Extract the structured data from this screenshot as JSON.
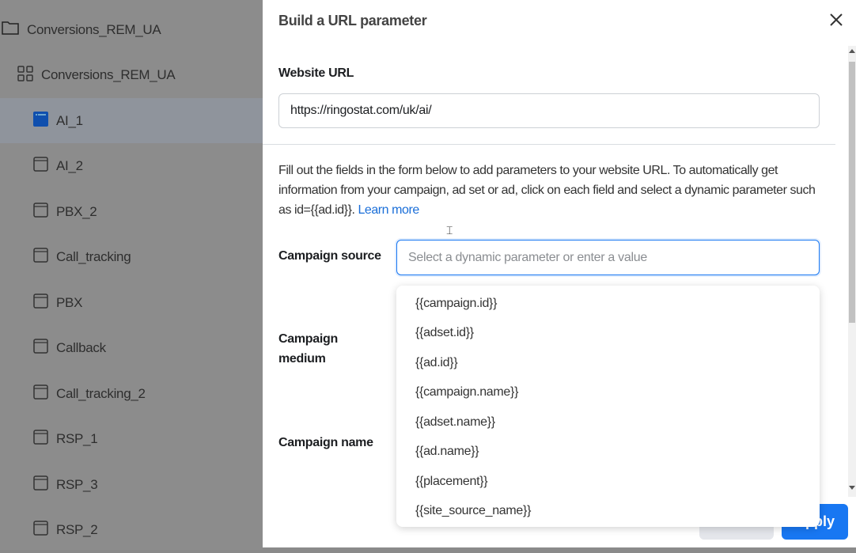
{
  "sidebar": {
    "items": [
      {
        "label": "Conversions_REM_UA",
        "icon": "folder-icon"
      },
      {
        "label": "Conversions_REM_UA",
        "icon": "grid-icon"
      },
      {
        "label": "AI_1",
        "icon": "ad-icon",
        "selected": true
      },
      {
        "label": "AI_2",
        "icon": "ad-icon"
      },
      {
        "label": "PBX_2",
        "icon": "ad-icon"
      },
      {
        "label": "Call_tracking",
        "icon": "ad-icon"
      },
      {
        "label": "PBX",
        "icon": "ad-icon"
      },
      {
        "label": "Callback",
        "icon": "ad-icon"
      },
      {
        "label": "Call_tracking_2",
        "icon": "ad-icon"
      },
      {
        "label": "RSP_1",
        "icon": "ad-icon"
      },
      {
        "label": "RSP_3",
        "icon": "ad-icon"
      },
      {
        "label": "RSP_2",
        "icon": "ad-icon"
      }
    ]
  },
  "modal": {
    "title": "Build a URL parameter",
    "website_url_label": "Website URL",
    "website_url_value": "https://ringostat.com/uk/ai/",
    "description": "Fill out the fields in the form below to add parameters to your website URL. To automatically get information from your campaign, ad set or ad, click on each field and select a dynamic parameter such as id={{ad.id}}. ",
    "learn_more": "Learn more",
    "campaign_source_label": "Campaign source",
    "campaign_source_placeholder": "Select a dynamic parameter or enter a value",
    "campaign_medium_label": "Campaign medium",
    "campaign_name_label": "Campaign name",
    "apply_label": "Apply",
    "accent_color": "#1877f2"
  },
  "dropdown": {
    "options": [
      "{{campaign.id}}",
      "{{adset.id}}",
      "{{ad.id}}",
      "{{campaign.name}}",
      "{{adset.name}}",
      "{{ad.name}}",
      "{{placement}}",
      "{{site_source_name}}"
    ]
  }
}
